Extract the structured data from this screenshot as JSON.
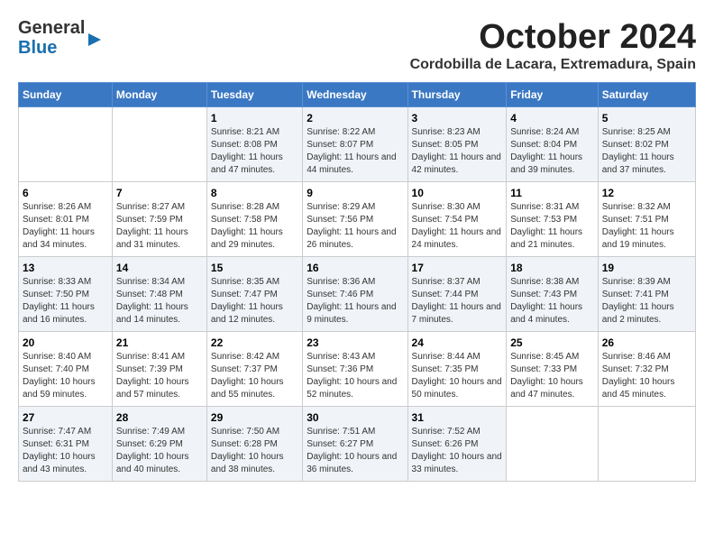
{
  "header": {
    "logo_top": "General",
    "logo_bottom": "Blue",
    "month": "October 2024",
    "location": "Cordobilla de Lacara, Extremadura, Spain"
  },
  "weekdays": [
    "Sunday",
    "Monday",
    "Tuesday",
    "Wednesday",
    "Thursday",
    "Friday",
    "Saturday"
  ],
  "weeks": [
    [
      {
        "day": "",
        "info": ""
      },
      {
        "day": "",
        "info": ""
      },
      {
        "day": "1",
        "info": "Sunrise: 8:21 AM\nSunset: 8:08 PM\nDaylight: 11 hours and 47 minutes."
      },
      {
        "day": "2",
        "info": "Sunrise: 8:22 AM\nSunset: 8:07 PM\nDaylight: 11 hours and 44 minutes."
      },
      {
        "day": "3",
        "info": "Sunrise: 8:23 AM\nSunset: 8:05 PM\nDaylight: 11 hours and 42 minutes."
      },
      {
        "day": "4",
        "info": "Sunrise: 8:24 AM\nSunset: 8:04 PM\nDaylight: 11 hours and 39 minutes."
      },
      {
        "day": "5",
        "info": "Sunrise: 8:25 AM\nSunset: 8:02 PM\nDaylight: 11 hours and 37 minutes."
      }
    ],
    [
      {
        "day": "6",
        "info": "Sunrise: 8:26 AM\nSunset: 8:01 PM\nDaylight: 11 hours and 34 minutes."
      },
      {
        "day": "7",
        "info": "Sunrise: 8:27 AM\nSunset: 7:59 PM\nDaylight: 11 hours and 31 minutes."
      },
      {
        "day": "8",
        "info": "Sunrise: 8:28 AM\nSunset: 7:58 PM\nDaylight: 11 hours and 29 minutes."
      },
      {
        "day": "9",
        "info": "Sunrise: 8:29 AM\nSunset: 7:56 PM\nDaylight: 11 hours and 26 minutes."
      },
      {
        "day": "10",
        "info": "Sunrise: 8:30 AM\nSunset: 7:54 PM\nDaylight: 11 hours and 24 minutes."
      },
      {
        "day": "11",
        "info": "Sunrise: 8:31 AM\nSunset: 7:53 PM\nDaylight: 11 hours and 21 minutes."
      },
      {
        "day": "12",
        "info": "Sunrise: 8:32 AM\nSunset: 7:51 PM\nDaylight: 11 hours and 19 minutes."
      }
    ],
    [
      {
        "day": "13",
        "info": "Sunrise: 8:33 AM\nSunset: 7:50 PM\nDaylight: 11 hours and 16 minutes."
      },
      {
        "day": "14",
        "info": "Sunrise: 8:34 AM\nSunset: 7:48 PM\nDaylight: 11 hours and 14 minutes."
      },
      {
        "day": "15",
        "info": "Sunrise: 8:35 AM\nSunset: 7:47 PM\nDaylight: 11 hours and 12 minutes."
      },
      {
        "day": "16",
        "info": "Sunrise: 8:36 AM\nSunset: 7:46 PM\nDaylight: 11 hours and 9 minutes."
      },
      {
        "day": "17",
        "info": "Sunrise: 8:37 AM\nSunset: 7:44 PM\nDaylight: 11 hours and 7 minutes."
      },
      {
        "day": "18",
        "info": "Sunrise: 8:38 AM\nSunset: 7:43 PM\nDaylight: 11 hours and 4 minutes."
      },
      {
        "day": "19",
        "info": "Sunrise: 8:39 AM\nSunset: 7:41 PM\nDaylight: 11 hours and 2 minutes."
      }
    ],
    [
      {
        "day": "20",
        "info": "Sunrise: 8:40 AM\nSunset: 7:40 PM\nDaylight: 10 hours and 59 minutes."
      },
      {
        "day": "21",
        "info": "Sunrise: 8:41 AM\nSunset: 7:39 PM\nDaylight: 10 hours and 57 minutes."
      },
      {
        "day": "22",
        "info": "Sunrise: 8:42 AM\nSunset: 7:37 PM\nDaylight: 10 hours and 55 minutes."
      },
      {
        "day": "23",
        "info": "Sunrise: 8:43 AM\nSunset: 7:36 PM\nDaylight: 10 hours and 52 minutes."
      },
      {
        "day": "24",
        "info": "Sunrise: 8:44 AM\nSunset: 7:35 PM\nDaylight: 10 hours and 50 minutes."
      },
      {
        "day": "25",
        "info": "Sunrise: 8:45 AM\nSunset: 7:33 PM\nDaylight: 10 hours and 47 minutes."
      },
      {
        "day": "26",
        "info": "Sunrise: 8:46 AM\nSunset: 7:32 PM\nDaylight: 10 hours and 45 minutes."
      }
    ],
    [
      {
        "day": "27",
        "info": "Sunrise: 7:47 AM\nSunset: 6:31 PM\nDaylight: 10 hours and 43 minutes."
      },
      {
        "day": "28",
        "info": "Sunrise: 7:49 AM\nSunset: 6:29 PM\nDaylight: 10 hours and 40 minutes."
      },
      {
        "day": "29",
        "info": "Sunrise: 7:50 AM\nSunset: 6:28 PM\nDaylight: 10 hours and 38 minutes."
      },
      {
        "day": "30",
        "info": "Sunrise: 7:51 AM\nSunset: 6:27 PM\nDaylight: 10 hours and 36 minutes."
      },
      {
        "day": "31",
        "info": "Sunrise: 7:52 AM\nSunset: 6:26 PM\nDaylight: 10 hours and 33 minutes."
      },
      {
        "day": "",
        "info": ""
      },
      {
        "day": "",
        "info": ""
      }
    ]
  ]
}
